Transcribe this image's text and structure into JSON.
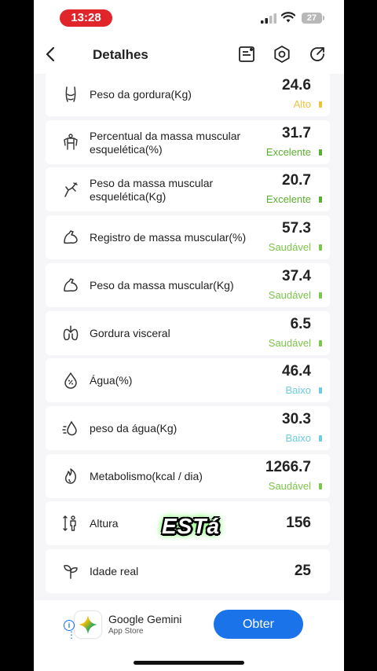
{
  "status_bar": {
    "time": "13:28",
    "battery": "27"
  },
  "header": {
    "title": "Detalhes",
    "icons": [
      "back-icon",
      "report-icon",
      "settings-icon",
      "share-icon"
    ]
  },
  "colors": {
    "alto": "#e7c53d",
    "excelente": "#5bae2f",
    "saudavel": "#7cc44b",
    "baixo": "#6fcce0",
    "button": "#1a73e8",
    "time_pill": "#e0252b"
  },
  "metrics": [
    {
      "icon": "fat-body-icon",
      "label": "Peso da gordura(Kg)",
      "value": "24.6",
      "status": "Alto",
      "status_color": "#e7c53d"
    },
    {
      "icon": "muscle-body-icon",
      "label": "Percentual da massa muscular esquelética(%)",
      "value": "31.7",
      "status": "Excelente",
      "status_color": "#5bae2f"
    },
    {
      "icon": "skeletal-muscle-icon",
      "label": "Peso da massa muscular esquelética(Kg)",
      "value": "20.7",
      "status": "Excelente",
      "status_color": "#5bae2f"
    },
    {
      "icon": "arm-muscle-icon",
      "label": "Registro de massa muscular(%)",
      "value": "57.3",
      "status": "Saudável",
      "status_color": "#7cc44b"
    },
    {
      "icon": "arm-muscle-icon",
      "label": "Peso da massa muscular(Kg)",
      "value": "37.4",
      "status": "Saudável",
      "status_color": "#7cc44b"
    },
    {
      "icon": "lungs-icon",
      "label": "Gordura visceral",
      "value": "6.5",
      "status": "Saudável",
      "status_color": "#7cc44b"
    },
    {
      "icon": "water-drop-percent-icon",
      "label": "Água(%)",
      "value": "46.4",
      "status": "Baixo",
      "status_color": "#6fcce0"
    },
    {
      "icon": "water-drop-icon",
      "label": "peso da água(Kg)",
      "value": "30.3",
      "status": "Baixo",
      "status_color": "#6fcce0"
    },
    {
      "icon": "flame-icon",
      "label": "Metabolismo(kcal / dia)",
      "value": "1266.7",
      "status": "Saudável",
      "status_color": "#7cc44b"
    },
    {
      "icon": "height-icon",
      "label": "Altura",
      "value": "156",
      "status": "",
      "status_color": ""
    },
    {
      "icon": "sprout-icon",
      "label": "Idade real",
      "value": "25",
      "status": "",
      "status_color": ""
    }
  ],
  "caption": "ESTá",
  "ad": {
    "name": "Google Gemini",
    "store": "App Store",
    "button": "Obter",
    "info_icon": "info-icon"
  }
}
